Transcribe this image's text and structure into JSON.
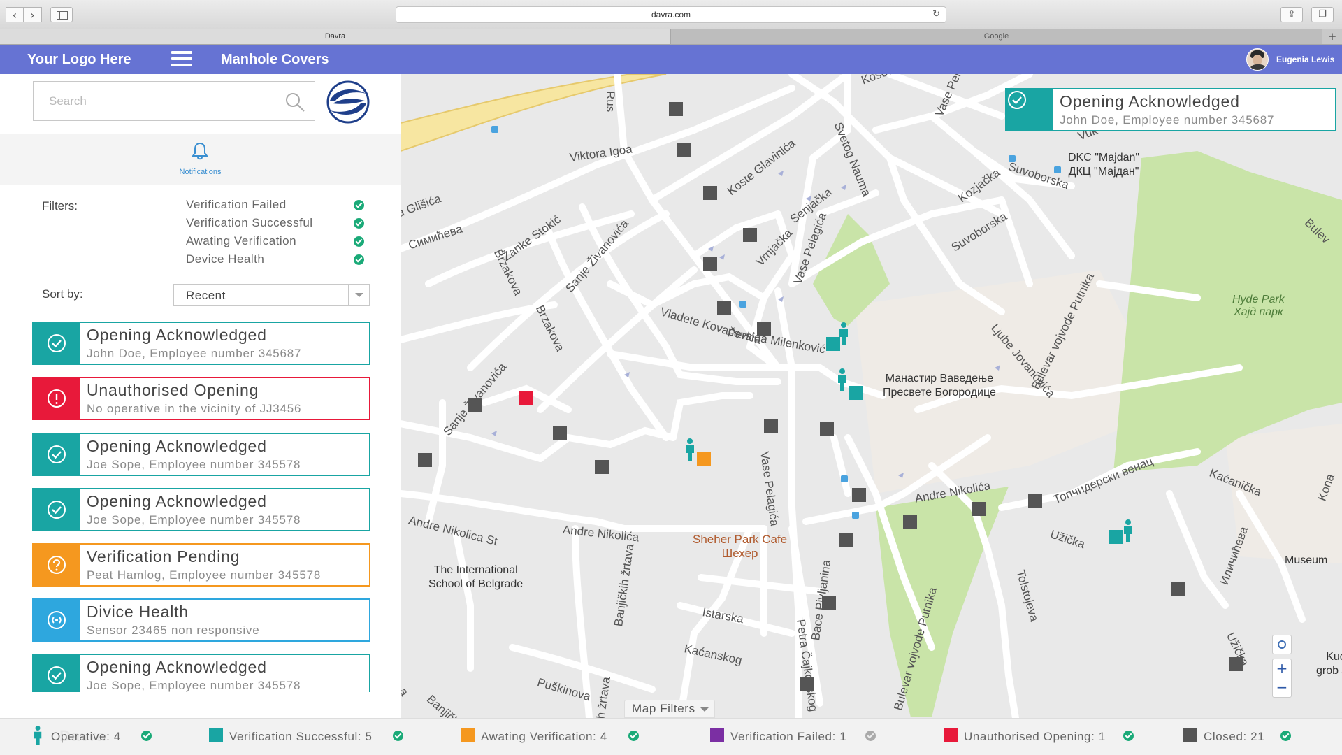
{
  "browser": {
    "url": "davra.com",
    "tabs": [
      {
        "label": "Davra",
        "active": true
      },
      {
        "label": "Google",
        "active": false
      }
    ],
    "add_tab": "+"
  },
  "header": {
    "logo": "Your Logo Here",
    "title": "Manhole Covers",
    "user": "Eugenia Lewis",
    "bg_color": "#6673d3"
  },
  "sidebar": {
    "search_placeholder": "Search",
    "notifications_label": "Notifications",
    "filters_label": "Filters:",
    "filters": [
      {
        "label": "Verification Failed",
        "checked": true
      },
      {
        "label": "Verification Successful",
        "checked": true
      },
      {
        "label": "Awating Verification",
        "checked": true
      },
      {
        "label": "Device Health",
        "checked": true
      }
    ],
    "sort_label": "Sort by:",
    "sort_value": "Recent",
    "notifications": [
      {
        "title": "Opening Acknowledged",
        "subtitle": "John Doe, Employee number 345687",
        "type": "success",
        "color": "#19a5a3",
        "icon": "check-circle-icon"
      },
      {
        "title": "Unauthorised Opening",
        "subtitle": "No operative in the vicinity of JJ3456",
        "type": "alert",
        "color": "#e8193a",
        "icon": "alert-circle-icon"
      },
      {
        "title": "Opening Acknowledged",
        "subtitle": "Joe Sope, Employee number 345578",
        "type": "success",
        "color": "#19a5a3",
        "icon": "check-circle-icon"
      },
      {
        "title": "Opening Acknowledged",
        "subtitle": "Joe Sope, Employee number 345578",
        "type": "success",
        "color": "#19a5a3",
        "icon": "check-circle-icon"
      },
      {
        "title": "Verification Pending",
        "subtitle": "Peat Hamlog, Employee number 345578",
        "type": "pending",
        "color": "#f5981f",
        "icon": "question-circle-icon"
      },
      {
        "title": "Divice Health",
        "subtitle": "Sensor 23465 non responsive",
        "type": "health",
        "color": "#2ea7de",
        "icon": "signal-circle-icon"
      },
      {
        "title": "Opening Acknowledged",
        "subtitle": "Joe Sope, Employee number 345578",
        "type": "success",
        "color": "#19a5a3",
        "icon": "check-circle-icon"
      }
    ]
  },
  "map": {
    "overlay": {
      "title": "Opening Acknowledged",
      "subtitle": "John Doe, Employee number 345687"
    },
    "map_filters_label": "Map Filters",
    "zoom_in": "+",
    "zoom_out": "−",
    "streets": [
      "Viktora Igoa",
      "Koste Glavinića",
      "Senjačka",
      "Svetog Nauma",
      "Vase Pelagića",
      "Kozjačka",
      "Suvoborska",
      "Suvoborska",
      "Sanje Živanovića",
      "Žanke Stokić",
      "Brzakova",
      "Brzakova",
      "Vrnjačka",
      "Vladete Kovačevića",
      "Persida Milenković",
      "Ljube Jovanovića",
      "Bulevar vojvode Putnika",
      "Sanje Živanovića",
      "Andre Nikolica St",
      "Andre Nikolića",
      "Andre Nikolića",
      "Vase Pelagića",
      "Banjičkih žrtava",
      "Istarska",
      "Kaćanskog",
      "Puškinova",
      "Petra Čajkovskog",
      "Bulevar vojvode Putnika",
      "Užička",
      "Tolstojeva",
      "Топчидерски венац",
      "Kaćanička",
      "Užička",
      "Иличићева",
      "a Glišića",
      "Симићева",
      "Banjičkih",
      "Vase Pela",
      "Bulev",
      "Kosovska",
      "Rus",
      "Vuk",
      "Kona",
      "Bace Pivljanina",
      "a",
      "ih žrtava"
    ],
    "pois": [
      {
        "name": "DKC \"Majdan\"\nДКЦ \"Мајдан\""
      },
      {
        "name": "Манастир Ваведење\nПресвете Богородице"
      },
      {
        "name": "The International\nSchool of Belgrade"
      },
      {
        "name": "Museum"
      },
      {
        "name": "Kuća\ngrob Josi"
      }
    ],
    "park": "Hyde Park\nХајд парк",
    "cafe": "Sheher Park Cafe\nШехер"
  },
  "legend": {
    "watermark": "Davra",
    "items": [
      {
        "label": "Operative: 4",
        "color": "#19a5a3",
        "checked": true
      },
      {
        "label": "Verification Successful: 5",
        "color": "#19a5a3",
        "checked": true
      },
      {
        "label": "Awating Verification: 4",
        "color": "#f5981f",
        "checked": true
      },
      {
        "label": "Verification Failed: 1",
        "color": "#7b2fa3",
        "checked": false
      },
      {
        "label": "Unauthorised Opening: 1",
        "color": "#e8193a",
        "checked": true
      },
      {
        "label": "Closed: 21",
        "color": "#555555",
        "checked": true
      }
    ]
  },
  "icons": {
    "notification": "bell-icon",
    "search": "search-icon",
    "operative": "person-icon"
  }
}
